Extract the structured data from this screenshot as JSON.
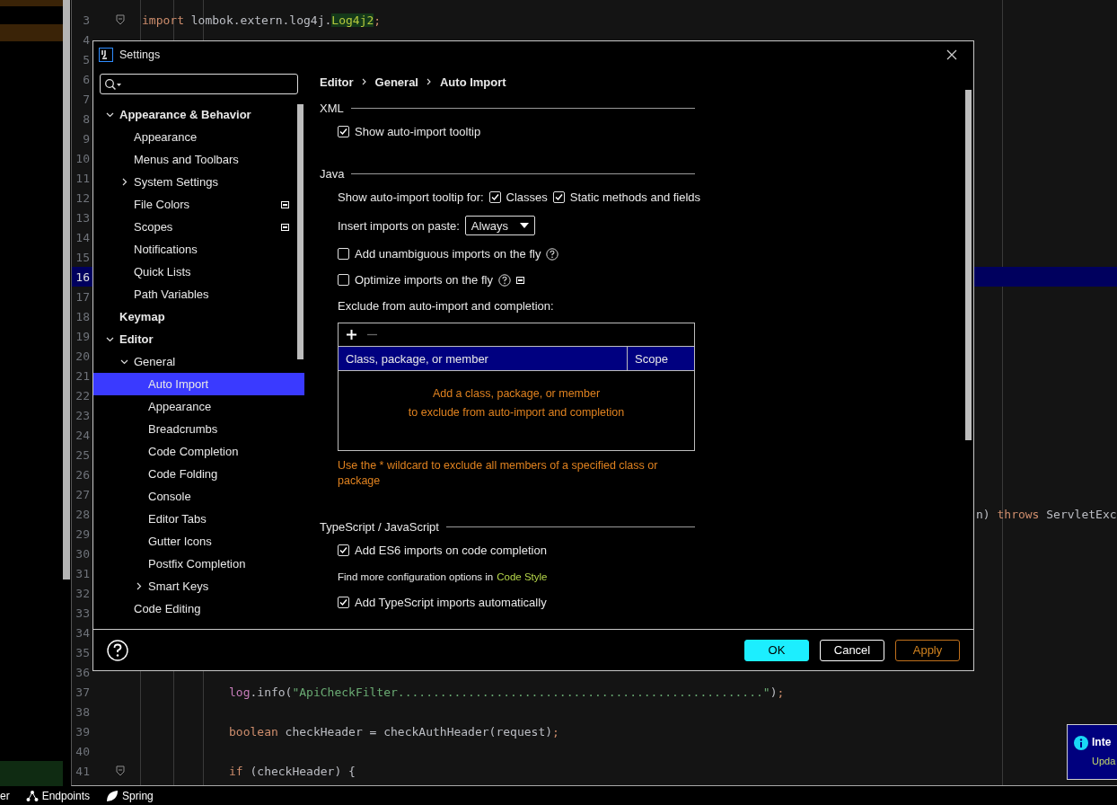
{
  "editor": {
    "lines": [
      {
        "n": "3",
        "current": false,
        "fold": true,
        "code": [
          {
            "t": "import",
            "kind": "keyword"
          },
          {
            "t": " lombok.extern.log4j.",
            "kind": "plain"
          },
          {
            "t": "Log4j2",
            "kind": "highlight"
          },
          {
            "t": ";",
            "kind": "keyword"
          }
        ]
      },
      {
        "n": "4",
        "current": false,
        "fold": false
      },
      {
        "n": "5",
        "current": false,
        "fold": false
      },
      {
        "n": "6",
        "current": false,
        "fold": false
      },
      {
        "n": "7",
        "current": false,
        "fold": false
      },
      {
        "n": "8",
        "current": false,
        "fold": false
      },
      {
        "n": "9",
        "current": false,
        "fold": false
      },
      {
        "n": "10",
        "current": false,
        "fold": false
      },
      {
        "n": "11",
        "current": false,
        "fold": false
      },
      {
        "n": "12",
        "current": false,
        "fold": false
      },
      {
        "n": "13",
        "current": false,
        "fold": false
      },
      {
        "n": "14",
        "current": false,
        "fold": false
      },
      {
        "n": "15",
        "current": false,
        "fold": false
      },
      {
        "n": "16",
        "current": true,
        "fold": false
      },
      {
        "n": "17",
        "current": false,
        "fold": false
      },
      {
        "n": "18",
        "current": false,
        "fold": false
      },
      {
        "n": "19",
        "current": false,
        "fold": false
      },
      {
        "n": "20",
        "current": false,
        "fold": false
      },
      {
        "n": "21",
        "current": false,
        "fold": false
      },
      {
        "n": "22",
        "current": false,
        "fold": false
      },
      {
        "n": "23",
        "current": false,
        "fold": false
      },
      {
        "n": "24",
        "current": false,
        "fold": false
      },
      {
        "n": "25",
        "current": false,
        "fold": false
      },
      {
        "n": "26",
        "current": false,
        "fold": false
      },
      {
        "n": "27",
        "current": false,
        "fold": false
      },
      {
        "n": "28",
        "current": false,
        "fold": false,
        "code": [
          {
            "t": "n) ",
            "kind": "plain"
          },
          {
            "t": "throws",
            "kind": "keyword"
          },
          {
            "t": " ServletExc",
            "kind": "plain"
          }
        ]
      },
      {
        "n": "29",
        "current": false,
        "fold": false
      },
      {
        "n": "30",
        "current": false,
        "fold": false
      },
      {
        "n": "31",
        "current": false,
        "fold": false
      },
      {
        "n": "32",
        "current": false,
        "fold": false
      },
      {
        "n": "33",
        "current": false,
        "fold": false
      },
      {
        "n": "34",
        "current": false,
        "fold": false
      },
      {
        "n": "35",
        "current": false,
        "fold": false
      },
      {
        "n": "36",
        "current": false,
        "fold": false
      },
      {
        "n": "37",
        "current": false,
        "fold": false,
        "code": [
          {
            "t": "log",
            "kind": "field"
          },
          {
            "t": ".info(",
            "kind": "plain"
          },
          {
            "t": "\"ApiCheckFilter....................................................\"",
            "kind": "string"
          },
          {
            "t": ")",
            "kind": "plain"
          },
          {
            "t": ";",
            "kind": "keyword"
          }
        ]
      },
      {
        "n": "38",
        "current": false,
        "fold": false
      },
      {
        "n": "39",
        "current": false,
        "fold": false,
        "code": [
          {
            "t": "boolean",
            "kind": "keyword"
          },
          {
            "t": " checkHeader = checkAuthHeader(request)",
            "kind": "plain"
          },
          {
            "t": ";",
            "kind": "keyword"
          }
        ]
      },
      {
        "n": "40",
        "current": false,
        "fold": false
      },
      {
        "n": "41",
        "current": false,
        "fold": true,
        "code": [
          {
            "t": "if",
            "kind": "keyword"
          },
          {
            "t": " (checkHeader) {",
            "kind": "plain"
          }
        ]
      }
    ]
  },
  "dialog": {
    "title": "Settings",
    "tree": [
      {
        "label": "Appearance & Behavior",
        "selected": false,
        "expanded": true,
        "project_icon": false,
        "children": [
          {
            "label": "Appearance",
            "selected": false,
            "project_icon": false
          },
          {
            "label": "Menus and Toolbars",
            "selected": false,
            "project_icon": false
          },
          {
            "label": "System Settings",
            "selected": false,
            "expanded": false,
            "project_icon": false
          },
          {
            "label": "File Colors",
            "selected": false,
            "project_icon": true
          },
          {
            "label": "Scopes",
            "selected": false,
            "project_icon": true
          },
          {
            "label": "Notifications",
            "selected": false,
            "project_icon": false
          },
          {
            "label": "Quick Lists",
            "selected": false,
            "project_icon": false
          },
          {
            "label": "Path Variables",
            "selected": false,
            "project_icon": false
          }
        ]
      },
      {
        "label": "Keymap",
        "selected": false,
        "project_icon": false
      },
      {
        "label": "Editor",
        "selected": false,
        "expanded": true,
        "project_icon": false,
        "children": [
          {
            "label": "General",
            "selected": false,
            "expanded": true,
            "project_icon": false,
            "children": [
              {
                "label": "Auto Import",
                "selected": true,
                "project_icon": false
              },
              {
                "label": "Appearance",
                "selected": false,
                "project_icon": false
              },
              {
                "label": "Breadcrumbs",
                "selected": false,
                "project_icon": false
              },
              {
                "label": "Code Completion",
                "selected": false,
                "project_icon": false
              },
              {
                "label": "Code Folding",
                "selected": false,
                "project_icon": false
              },
              {
                "label": "Console",
                "selected": false,
                "project_icon": false
              },
              {
                "label": "Editor Tabs",
                "selected": false,
                "project_icon": false
              },
              {
                "label": "Gutter Icons",
                "selected": false,
                "project_icon": false
              },
              {
                "label": "Postfix Completion",
                "selected": false,
                "project_icon": false
              },
              {
                "label": "Smart Keys",
                "selected": false,
                "expanded": false,
                "project_icon": false
              }
            ]
          },
          {
            "label": "Code Editing",
            "selected": false,
            "project_icon": false
          }
        ]
      }
    ],
    "breadcrumb": [
      "Editor",
      "General",
      "Auto Import"
    ],
    "sections": [
      {
        "title": "XML",
        "items": [
          {
            "kind": "checkbox",
            "label": "Show auto-import tooltip",
            "checked": true,
            "help": false,
            "project_icon": false
          }
        ]
      },
      {
        "title": "Java",
        "items": [
          {
            "kind": "checkbox_group",
            "label": "Show auto-import tooltip for:",
            "options": [
              {
                "label": "Classes",
                "checked": true
              },
              {
                "label": "Static methods and fields",
                "checked": true
              }
            ]
          },
          {
            "kind": "dropdown",
            "label": "Insert imports on paste:",
            "value": "Always"
          },
          {
            "kind": "checkbox",
            "label": "Add unambiguous imports on the fly",
            "checked": false,
            "help": true,
            "project_icon": false
          },
          {
            "kind": "checkbox",
            "label": "Optimize imports on the fly",
            "checked": false,
            "help": true,
            "project_icon": true
          },
          {
            "kind": "label",
            "text": "Exclude from auto-import and completion:"
          },
          {
            "kind": "table",
            "columns": [
              "Class, package, or member",
              "Scope"
            ],
            "empty_text": [
              "Add a class, package, or member",
              "to exclude from auto-import and completion"
            ]
          },
          {
            "kind": "hint",
            "text": "Use the * wildcard to exclude all members of a specified class or package"
          }
        ]
      },
      {
        "title": "TypeScript / JavaScript",
        "items": [
          {
            "kind": "checkbox",
            "label": "Add ES6 imports on code completion",
            "checked": true,
            "help": false,
            "project_icon": false
          },
          {
            "kind": "link_text",
            "text": "Find more configuration options in",
            "link": "Code Style"
          },
          {
            "kind": "checkbox",
            "label": "Add TypeScript imports automatically",
            "checked": true,
            "help": false,
            "project_icon": false
          }
        ]
      }
    ],
    "buttons": [
      {
        "label": "OK",
        "kind": "primary"
      },
      {
        "label": "Cancel",
        "kind": "normal"
      },
      {
        "label": "Apply",
        "kind": "apply"
      }
    ]
  },
  "notification": {
    "title": "Inte",
    "text": "Upda"
  },
  "status_bar": [
    {
      "label": "er",
      "kind": "plain"
    },
    {
      "label": "Endpoints",
      "kind": "endpoints"
    },
    {
      "label": "Spring",
      "kind": "spring"
    }
  ]
}
